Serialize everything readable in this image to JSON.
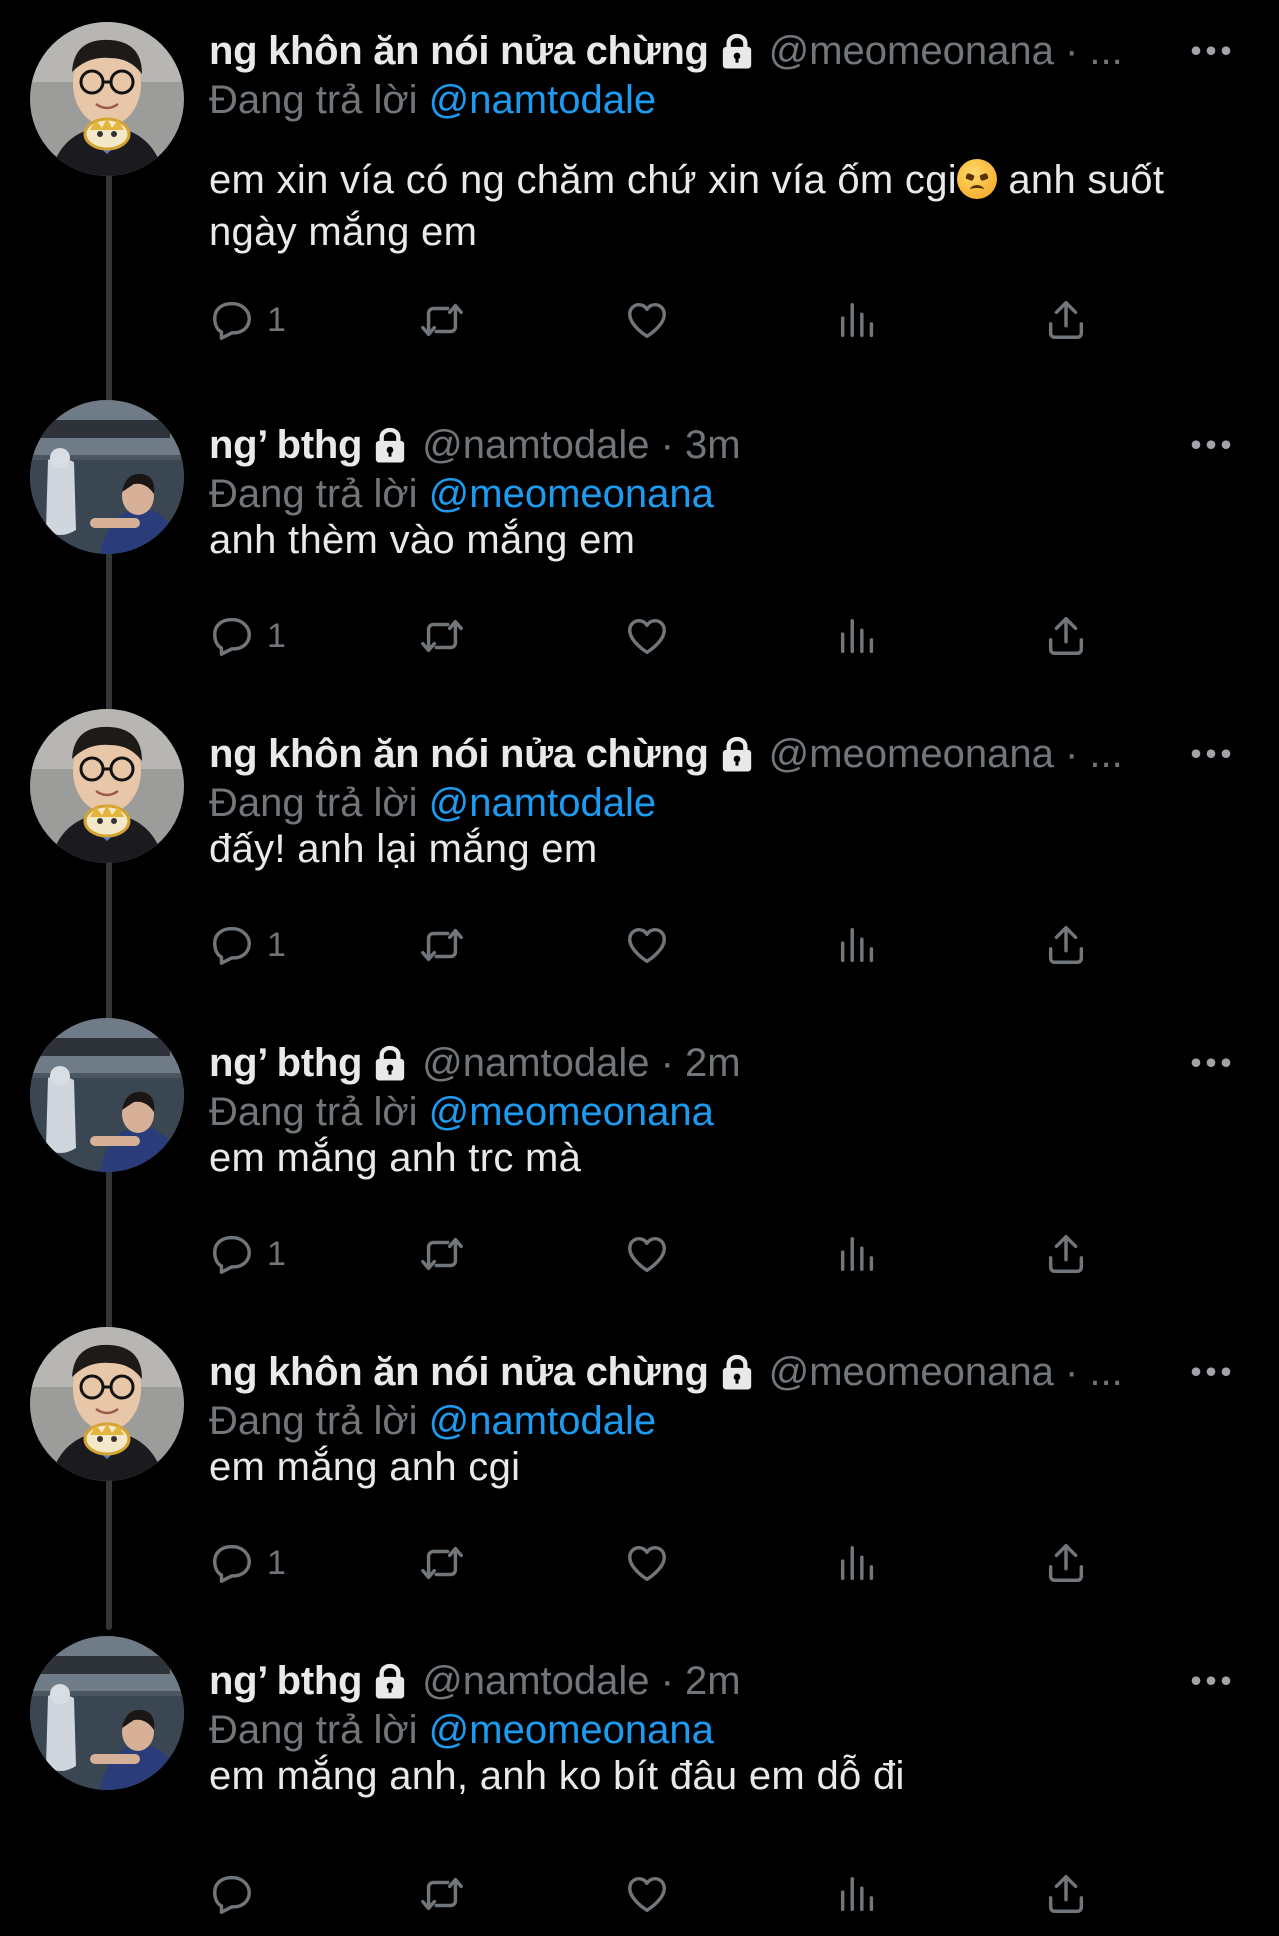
{
  "accent_color": "#1d9bf0",
  "muted_color": "#71767b",
  "tweets": [
    {
      "avatar": "avatar-glasses-boy",
      "name": "ng khôn ăn nói nửa chừng",
      "handle_meta": "@meomeonana · ...",
      "reply_prefix": "Đang trả lời",
      "reply_mention": "@namtodale",
      "text_before_emoji": "em xin vía có ng chăm chứ xin vía ốm cgi",
      "emoji": "angry-face-emoji",
      "text_after_emoji": " anh suốt ngày mắng em",
      "reply_count": "1"
    },
    {
      "avatar": "avatar-boat-photo",
      "name": "ng’ bthg",
      "handle_meta": "@namtodale · 3m",
      "reply_prefix": "Đang trả lời",
      "reply_mention": "@meomeonana",
      "text": "anh thèm vào mắng em",
      "reply_count": "1"
    },
    {
      "avatar": "avatar-glasses-boy",
      "name": "ng khôn ăn nói nửa chừng",
      "handle_meta": "@meomeonana · ...",
      "reply_prefix": "Đang trả lời",
      "reply_mention": "@namtodale",
      "text": "đấy! anh lại mắng em",
      "reply_count": "1"
    },
    {
      "avatar": "avatar-boat-photo",
      "name": "ng’ bthg",
      "handle_meta": "@namtodale · 2m",
      "reply_prefix": "Đang trả lời",
      "reply_mention": "@meomeonana",
      "text": "em mắng anh trc mà",
      "reply_count": "1"
    },
    {
      "avatar": "avatar-glasses-boy",
      "name": "ng khôn ăn nói nửa chừng",
      "handle_meta": "@meomeonana · ...",
      "reply_prefix": "Đang trả lời",
      "reply_mention": "@namtodale",
      "text": "em mắng anh cgi",
      "reply_count": "1"
    },
    {
      "avatar": "avatar-boat-photo",
      "name": "ng’ bthg",
      "handle_meta": "@namtodale · 2m",
      "reply_prefix": "Đang trả lời",
      "reply_mention": "@meomeonana",
      "text": "em mắng anh, anh ko bít đâu em dỗ đi",
      "reply_count": ""
    }
  ],
  "icons": {
    "lock": "lock-icon",
    "more": "more-icon",
    "reply": "reply-icon",
    "retweet": "retweet-icon",
    "like": "like-icon",
    "views": "views-icon",
    "share": "share-icon"
  }
}
